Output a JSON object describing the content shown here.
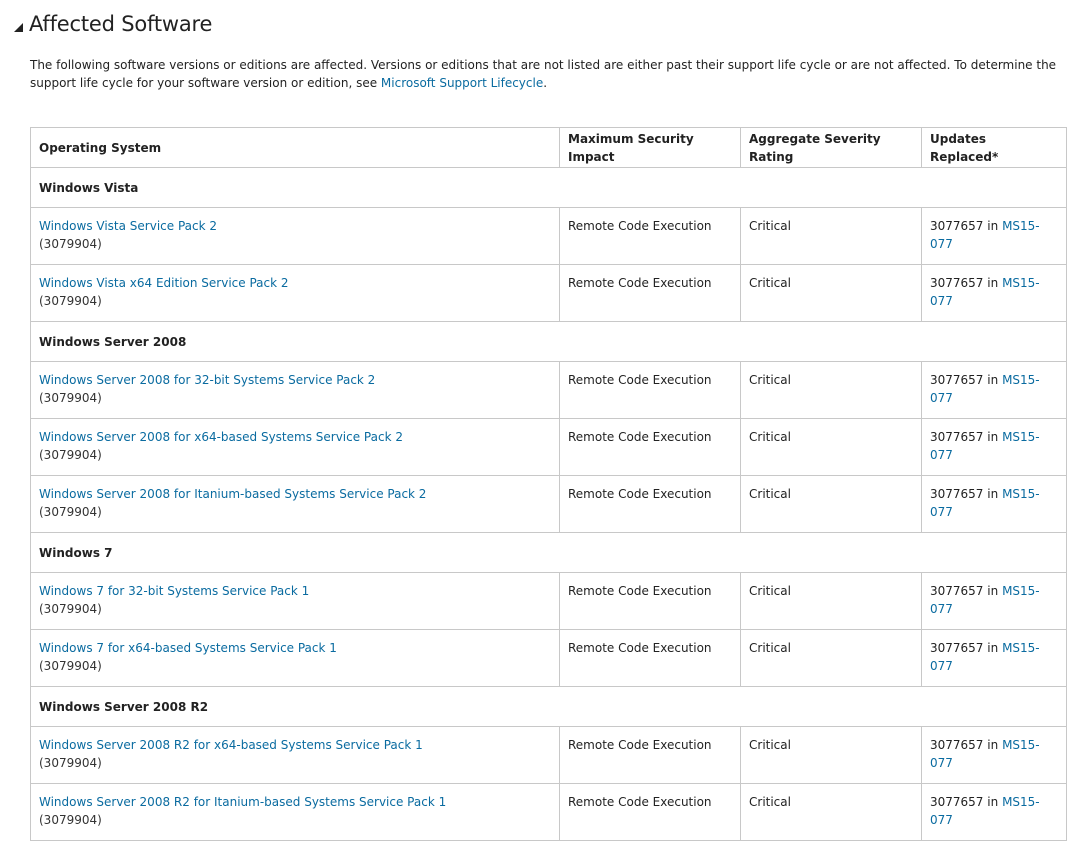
{
  "section": {
    "title": "Affected Software",
    "intro_text": "The following software versions or editions are affected. Versions or editions that are not listed are either past their support life cycle or are not affected. To determine the support life cycle for your software version or edition, see ",
    "intro_link": "Microsoft Support Lifecycle",
    "intro_end": "."
  },
  "table": {
    "headers": [
      "Operating System",
      "Maximum Security Impact",
      "Aggregate Severity Rating",
      "Updates Replaced*"
    ],
    "replaced_in": "in",
    "groups": [
      {
        "name": "Windows Vista",
        "rows": [
          {
            "os": "Windows Vista Service Pack 2",
            "kb": "(3079904)",
            "impact": "Remote Code Execution",
            "severity": "Critical",
            "replaced_kb": "3077657",
            "replaced_bulletin": "MS15-077"
          },
          {
            "os": "Windows Vista x64 Edition Service Pack 2",
            "kb": "(3079904)",
            "impact": "Remote Code Execution",
            "severity": "Critical",
            "replaced_kb": "3077657",
            "replaced_bulletin": "MS15-077"
          }
        ]
      },
      {
        "name": "Windows Server 2008",
        "rows": [
          {
            "os": "Windows Server 2008 for 32-bit Systems Service Pack 2",
            "kb": "(3079904)",
            "impact": "Remote Code Execution",
            "severity": "Critical",
            "replaced_kb": "3077657",
            "replaced_bulletin": "MS15-077"
          },
          {
            "os": "Windows Server 2008 for x64-based Systems Service Pack 2",
            "kb": "(3079904)",
            "impact": "Remote Code Execution",
            "severity": "Critical",
            "replaced_kb": "3077657",
            "replaced_bulletin": "MS15-077"
          },
          {
            "os": "Windows Server 2008 for Itanium-based Systems Service Pack 2",
            "kb": "(3079904)",
            "impact": "Remote Code Execution",
            "severity": "Critical",
            "replaced_kb": "3077657",
            "replaced_bulletin": "MS15-077"
          }
        ]
      },
      {
        "name": "Windows 7",
        "rows": [
          {
            "os": "Windows 7 for 32-bit Systems Service Pack 1",
            "kb": "(3079904)",
            "impact": "Remote Code Execution",
            "severity": "Critical",
            "replaced_kb": "3077657",
            "replaced_bulletin": "MS15-077"
          },
          {
            "os": "Windows 7 for x64-based Systems Service Pack 1",
            "kb": "(3079904)",
            "impact": "Remote Code Execution",
            "severity": "Critical",
            "replaced_kb": "3077657",
            "replaced_bulletin": "MS15-077"
          }
        ]
      },
      {
        "name": "Windows Server 2008 R2",
        "rows": [
          {
            "os": "Windows Server 2008 R2 for x64-based Systems Service Pack 1",
            "kb": "(3079904)",
            "impact": "Remote Code Execution",
            "severity": "Critical",
            "replaced_kb": "3077657",
            "replaced_bulletin": "MS15-077"
          },
          {
            "os": "Windows Server 2008 R2 for Itanium-based Systems Service Pack 1",
            "kb": "(3079904)",
            "impact": "Remote Code Execution",
            "severity": "Critical",
            "replaced_kb": "3077657",
            "replaced_bulletin": "MS15-077"
          }
        ]
      }
    ]
  },
  "colors": {
    "link": "#0a6ba0",
    "border": "#c8c8c8",
    "text": "#222222"
  },
  "icons": {
    "toggle": "collapse-triangle-icon"
  }
}
